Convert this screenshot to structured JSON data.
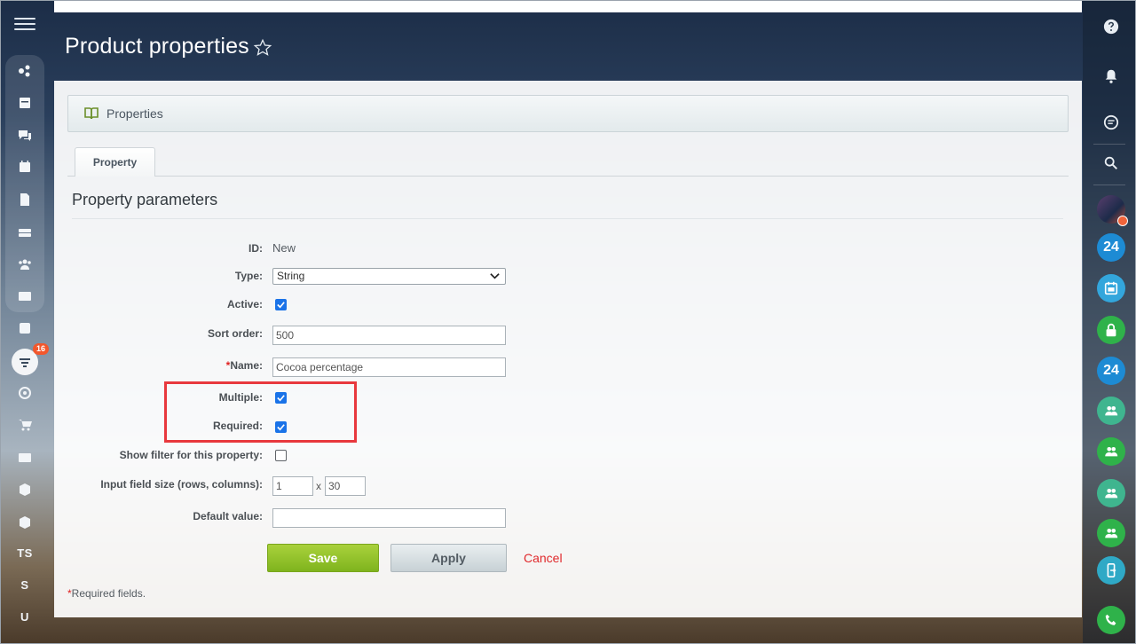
{
  "page": {
    "title": "Product properties"
  },
  "left_sidebar": {
    "badge_count": "16",
    "letters": [
      "TS",
      "S",
      "U"
    ]
  },
  "panel": {
    "header_label": "Properties",
    "tab_label": "Property",
    "section_title": "Property parameters"
  },
  "form": {
    "id_label": "ID:",
    "id_value": "New",
    "type_label": "Type:",
    "type_value": "String",
    "active_label": "Active:",
    "active_checked": true,
    "sort_label": "Sort order:",
    "sort_value": "500",
    "name_required_mark": "*",
    "name_label": "Name:",
    "name_value": "Cocoa percentage",
    "multiple_label": "Multiple:",
    "multiple_checked": true,
    "required_label": "Required:",
    "required_checked": true,
    "filter_label": "Show filter for this property:",
    "filter_checked": false,
    "size_label": "Input field size (rows, columns):",
    "size_rows": "1",
    "size_sep": "x",
    "size_cols": "30",
    "default_label": "Default value:",
    "default_value": ""
  },
  "actions": {
    "save": "Save",
    "apply": "Apply",
    "cancel": "Cancel"
  },
  "footer": {
    "required_mark": "*",
    "required_note": "Required fields."
  },
  "right_sidebar": {
    "b24_label_1": "24",
    "b24_label_2": "24"
  },
  "colors": {
    "accent_green": "#7fb41e",
    "cancel_red": "#e0282b",
    "highlight_red": "#e8383d",
    "checkbox_blue": "#1a73e8"
  }
}
